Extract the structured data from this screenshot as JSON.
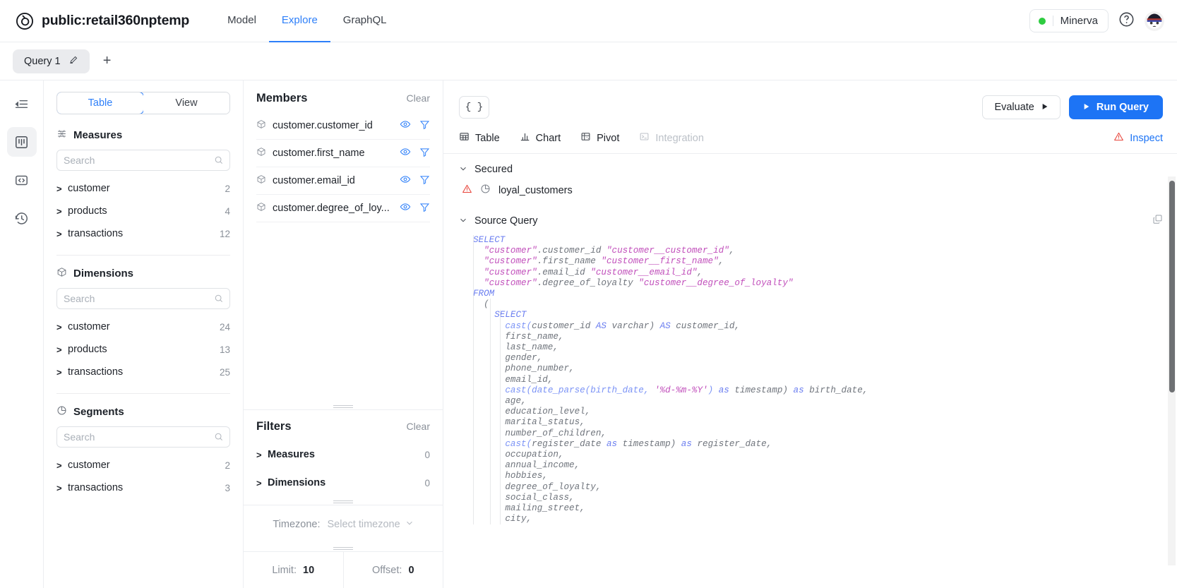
{
  "header": {
    "logo_icon": "target-circle-icon",
    "title": "public:retail360nptemp",
    "nav": [
      {
        "label": "Model",
        "active": false
      },
      {
        "label": "Explore",
        "active": true
      },
      {
        "label": "GraphQL",
        "active": false
      }
    ],
    "status": {
      "name": "Minerva",
      "dot_color": "#2ecc40"
    },
    "help_icon": "question-circle-icon",
    "avatar_icon": "user-avatar"
  },
  "tabbar": {
    "tabs": [
      {
        "label": "Query 1",
        "edit_icon": "pencil-icon"
      }
    ],
    "add_label": "+"
  },
  "rail": {
    "items": [
      {
        "icon": "collapse-sidebar-icon",
        "active": false
      },
      {
        "icon": "columns-panel-icon",
        "active": true
      },
      {
        "icon": "code-brackets-icon",
        "active": false
      },
      {
        "icon": "history-clock-icon",
        "active": false
      }
    ]
  },
  "left_panel": {
    "view_toggle": [
      {
        "label": "Table",
        "active": true
      },
      {
        "label": "View",
        "active": false
      }
    ],
    "sections": [
      {
        "title": "Measures",
        "icon": "measures-icon",
        "search_placeholder": "Search",
        "search_value": "",
        "items": [
          {
            "label": "customer",
            "count": "2"
          },
          {
            "label": "products",
            "count": "4"
          },
          {
            "label": "transactions",
            "count": "12"
          }
        ]
      },
      {
        "title": "Dimensions",
        "icon": "cube-icon",
        "search_placeholder": "Search",
        "search_value": "",
        "items": [
          {
            "label": "customer",
            "count": "24"
          },
          {
            "label": "products",
            "count": "13"
          },
          {
            "label": "transactions",
            "count": "25"
          }
        ]
      },
      {
        "title": "Segments",
        "icon": "pie-chart-icon",
        "search_placeholder": "Search",
        "search_value": "",
        "items": [
          {
            "label": "customer",
            "count": "2"
          },
          {
            "label": "transactions",
            "count": "3"
          }
        ]
      }
    ]
  },
  "members_panel": {
    "title": "Members",
    "clear_label": "Clear",
    "rows": [
      {
        "icon": "cube-icon",
        "name": "customer.customer_id",
        "eye_icon": "eye-icon",
        "filter_icon": "funnel-icon"
      },
      {
        "icon": "cube-icon",
        "name": "customer.first_name",
        "eye_icon": "eye-icon",
        "filter_icon": "funnel-icon"
      },
      {
        "icon": "cube-icon",
        "name": "customer.email_id",
        "eye_icon": "eye-icon",
        "filter_icon": "funnel-icon"
      },
      {
        "icon": "cube-icon",
        "name": "customer.degree_of_loy...",
        "eye_icon": "eye-icon",
        "filter_icon": "funnel-icon"
      }
    ]
  },
  "filters_panel": {
    "title": "Filters",
    "clear_label": "Clear",
    "rows": [
      {
        "label": "Measures",
        "count": "0"
      },
      {
        "label": "Dimensions",
        "count": "0"
      }
    ],
    "timezone_label": "Timezone:",
    "timezone_value": "Select timezone",
    "limit_label": "Limit:",
    "limit_value": "10",
    "offset_label": "Offset:",
    "offset_value": "0"
  },
  "main": {
    "json_button": "{ }",
    "evaluate_label": "Evaluate",
    "run_label": "Run Query",
    "tabs": [
      {
        "label": "Table",
        "icon": "table-grid-icon",
        "active": true,
        "disabled": false
      },
      {
        "label": "Chart",
        "icon": "bar-chart-icon",
        "active": false,
        "disabled": false
      },
      {
        "label": "Pivot",
        "icon": "pivot-grid-icon",
        "active": false,
        "disabled": false
      },
      {
        "label": "Integration",
        "icon": "terminal-icon",
        "active": false,
        "disabled": true
      }
    ],
    "inspect_label": "Inspect",
    "inspect_icon": "warning-triangle-icon",
    "secured": {
      "heading": "Secured",
      "chevron": "chevron-down-icon",
      "item": {
        "warning_icon": "warning-triangle-icon",
        "type_icon": "pie-chart-icon",
        "label": "loyal_customers"
      }
    },
    "source_query": {
      "heading": "Source Query",
      "chevron": "chevron-down-icon",
      "copy_icon": "copy-icon",
      "lines": [
        [
          {
            "t": "SELECT",
            "c": "kw"
          }
        ],
        [
          {
            "t": "  ",
            "c": ""
          },
          {
            "t": "\"customer\"",
            "c": "str"
          },
          {
            "t": ".customer_id ",
            "c": ""
          },
          {
            "t": "\"customer__customer_id\"",
            "c": "str"
          },
          {
            "t": ",",
            "c": ""
          }
        ],
        [
          {
            "t": "  ",
            "c": ""
          },
          {
            "t": "\"customer\"",
            "c": "str"
          },
          {
            "t": ".first_name ",
            "c": ""
          },
          {
            "t": "\"customer__first_name\"",
            "c": "str"
          },
          {
            "t": ",",
            "c": ""
          }
        ],
        [
          {
            "t": "  ",
            "c": ""
          },
          {
            "t": "\"customer\"",
            "c": "str"
          },
          {
            "t": ".email_id ",
            "c": ""
          },
          {
            "t": "\"customer__email_id\"",
            "c": "str"
          },
          {
            "t": ",",
            "c": ""
          }
        ],
        [
          {
            "t": "  ",
            "c": ""
          },
          {
            "t": "\"customer\"",
            "c": "str"
          },
          {
            "t": ".degree_of_loyalty ",
            "c": ""
          },
          {
            "t": "\"customer__degree_of_loyalty\"",
            "c": "str"
          }
        ],
        [
          {
            "t": "FROM",
            "c": "kw"
          }
        ],
        [
          {
            "t": "  (",
            "c": ""
          }
        ],
        [
          {
            "t": "    ",
            "c": ""
          },
          {
            "t": "SELECT",
            "c": "kw"
          }
        ],
        [
          {
            "t": "      ",
            "c": ""
          },
          {
            "t": "cast(",
            "c": "fn"
          },
          {
            "t": "customer_id ",
            "c": ""
          },
          {
            "t": "AS",
            "c": "kw"
          },
          {
            "t": " varchar) ",
            "c": ""
          },
          {
            "t": "AS",
            "c": "kw"
          },
          {
            "t": " customer_id,",
            "c": ""
          }
        ],
        [
          {
            "t": "      first_name,",
            "c": ""
          }
        ],
        [
          {
            "t": "      last_name,",
            "c": ""
          }
        ],
        [
          {
            "t": "      gender,",
            "c": ""
          }
        ],
        [
          {
            "t": "      phone_number,",
            "c": ""
          }
        ],
        [
          {
            "t": "      email_id,",
            "c": ""
          }
        ],
        [
          {
            "t": "      ",
            "c": ""
          },
          {
            "t": "cast(date_parse(birth_date, ",
            "c": "fn"
          },
          {
            "t": "'%d-%m-%Y'",
            "c": "str"
          },
          {
            "t": ")",
            "c": "fn"
          },
          {
            "t": " ",
            "c": ""
          },
          {
            "t": "as",
            "c": "kw"
          },
          {
            "t": " timestamp) ",
            "c": ""
          },
          {
            "t": "as",
            "c": "kw"
          },
          {
            "t": " birth_date,",
            "c": ""
          }
        ],
        [
          {
            "t": "      age,",
            "c": ""
          }
        ],
        [
          {
            "t": "      education_level,",
            "c": ""
          }
        ],
        [
          {
            "t": "      marital_status,",
            "c": ""
          }
        ],
        [
          {
            "t": "      number_of_children,",
            "c": ""
          }
        ],
        [
          {
            "t": "      ",
            "c": ""
          },
          {
            "t": "cast(",
            "c": "fn"
          },
          {
            "t": "register_date ",
            "c": ""
          },
          {
            "t": "as",
            "c": "kw"
          },
          {
            "t": " timestamp) ",
            "c": ""
          },
          {
            "t": "as",
            "c": "kw"
          },
          {
            "t": " register_date,",
            "c": ""
          }
        ],
        [
          {
            "t": "      occupation,",
            "c": ""
          }
        ],
        [
          {
            "t": "      annual_income,",
            "c": ""
          }
        ],
        [
          {
            "t": "      hobbies,",
            "c": ""
          }
        ],
        [
          {
            "t": "      degree_of_loyalty,",
            "c": ""
          }
        ],
        [
          {
            "t": "      social_class,",
            "c": ""
          }
        ],
        [
          {
            "t": "      mailing_street,",
            "c": ""
          }
        ],
        [
          {
            "t": "      city,",
            "c": ""
          }
        ]
      ]
    }
  }
}
